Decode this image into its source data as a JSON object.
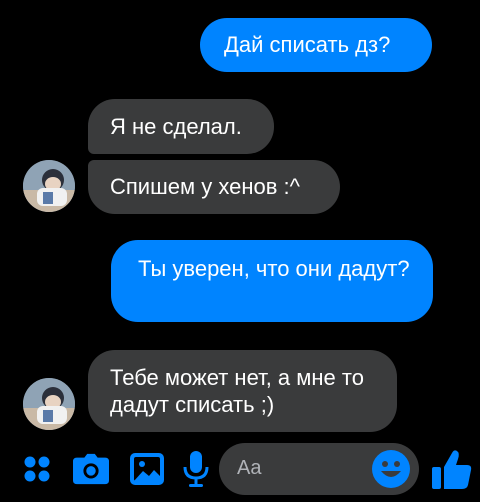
{
  "messages": [
    {
      "id": "m1",
      "direction": "outgoing",
      "text": "Дай списать дз?"
    },
    {
      "id": "m2",
      "direction": "incoming",
      "text": "Я не сделал."
    },
    {
      "id": "m3",
      "direction": "incoming",
      "text": "Спишем у хенов :^"
    },
    {
      "id": "m4",
      "direction": "outgoing",
      "text": "Ты уверен, что они дадут?"
    },
    {
      "id": "m5",
      "direction": "incoming",
      "text": "Тебе может нет, а мне то дадут списать ;)"
    }
  ],
  "composer": {
    "placeholder": "Aa"
  },
  "colors": {
    "outgoing": "#0084ff",
    "incoming": "#3a3b3c",
    "accent": "#0084ff",
    "background": "#000000"
  },
  "toolbar": {
    "icons": [
      "apps-icon",
      "camera-icon",
      "image-icon",
      "microphone-icon"
    ]
  }
}
